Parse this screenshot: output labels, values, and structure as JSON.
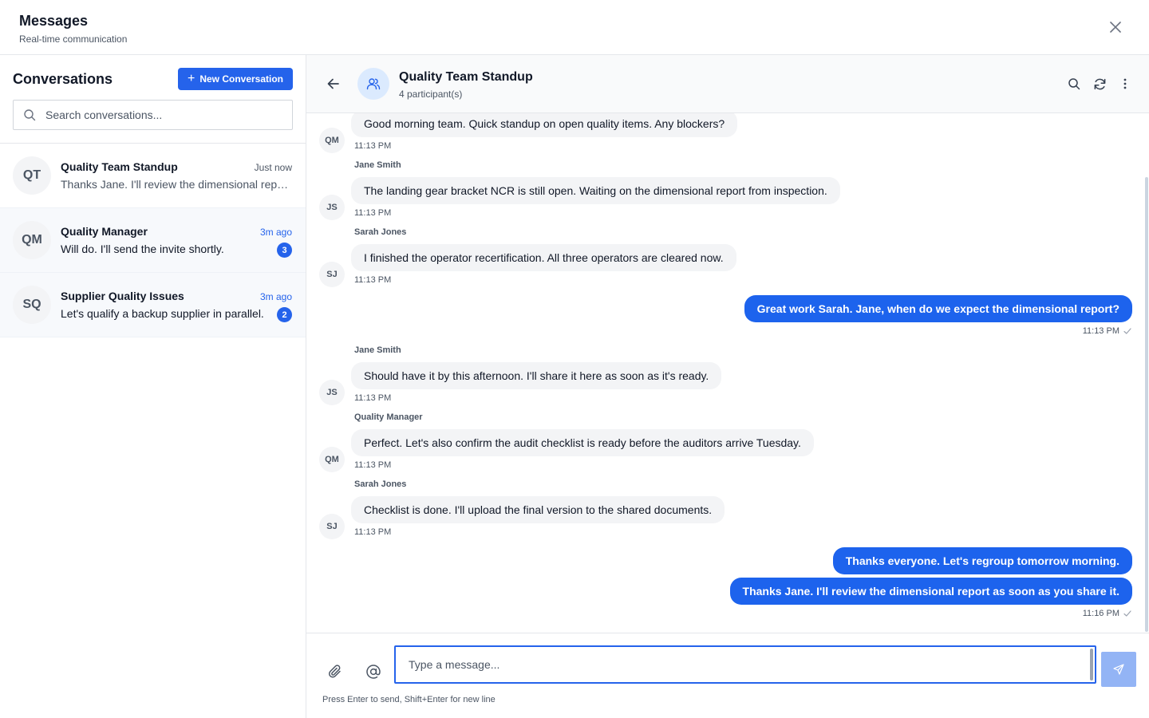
{
  "app": {
    "title": "Messages",
    "subtitle": "Real-time communication"
  },
  "sidebar": {
    "title": "Conversations",
    "new_button": "New Conversation",
    "search_placeholder": "Search conversations...",
    "conversations": [
      {
        "initials": "QT",
        "name": "Quality Team Standup",
        "time": "Just now",
        "preview": "Thanks Jane. I'll review the dimensional report as soon as you share it.",
        "unread": null
      },
      {
        "initials": "QM",
        "name": "Quality Manager",
        "time": "3m ago",
        "preview": "Will do. I'll send the invite shortly.",
        "unread": "3"
      },
      {
        "initials": "SQ",
        "name": "Supplier Quality Issues",
        "time": "3m ago",
        "preview": "Let's qualify a backup supplier in parallel.",
        "unread": "2"
      }
    ]
  },
  "chat": {
    "title": "Quality Team Standup",
    "participants": "4 participant(s)",
    "messages": [
      {
        "initials": "QM",
        "sender": "",
        "text": "Good morning team. Quick standup on open quality items. Any blockers?",
        "time": "11:13 PM"
      },
      {
        "initials": "JS",
        "sender": "Jane Smith",
        "text": "The landing gear bracket NCR is still open. Waiting on the dimensional report from inspection.",
        "time": "11:13 PM"
      },
      {
        "initials": "SJ",
        "sender": "Sarah Jones",
        "text": "I finished the operator recertification. All three operators are cleared now.",
        "time": "11:13 PM"
      },
      {
        "outgoing": true,
        "text": "Great work Sarah. Jane, when do we expect the dimensional report?",
        "time": "11:13 PM"
      },
      {
        "initials": "JS",
        "sender": "Jane Smith",
        "text": "Should have it by this afternoon. I'll share it here as soon as it's ready.",
        "time": "11:13 PM"
      },
      {
        "initials": "QM",
        "sender": "Quality Manager",
        "text": "Perfect. Let's also confirm the audit checklist is ready before the auditors arrive Tuesday.",
        "time": "11:13 PM"
      },
      {
        "initials": "SJ",
        "sender": "Sarah Jones",
        "text": "Checklist is done. I'll upload the final version to the shared documents.",
        "time": "11:13 PM"
      },
      {
        "outgoing": true,
        "text": "Thanks everyone. Let's regroup tomorrow morning.",
        "time": ""
      },
      {
        "outgoing": true,
        "text": "Thanks Jane. I'll review the dimensional report as soon as you share it.",
        "time": "11:16 PM"
      }
    ]
  },
  "composer": {
    "placeholder": "Type a message...",
    "hint": "Press Enter to send, Shift+Enter for new line"
  },
  "colors": {
    "accent": "#2563eb",
    "outgoing_bubble": "#1d63ed",
    "incoming_bubble": "#f3f4f6",
    "send_disabled": "#93b4f5"
  },
  "icons": [
    "close-icon",
    "plus-icon",
    "search-icon",
    "back-arrow-icon",
    "group-icon",
    "refresh-icon",
    "more-vertical-icon",
    "paperclip-icon",
    "at-sign-icon",
    "send-icon",
    "check-icon"
  ]
}
